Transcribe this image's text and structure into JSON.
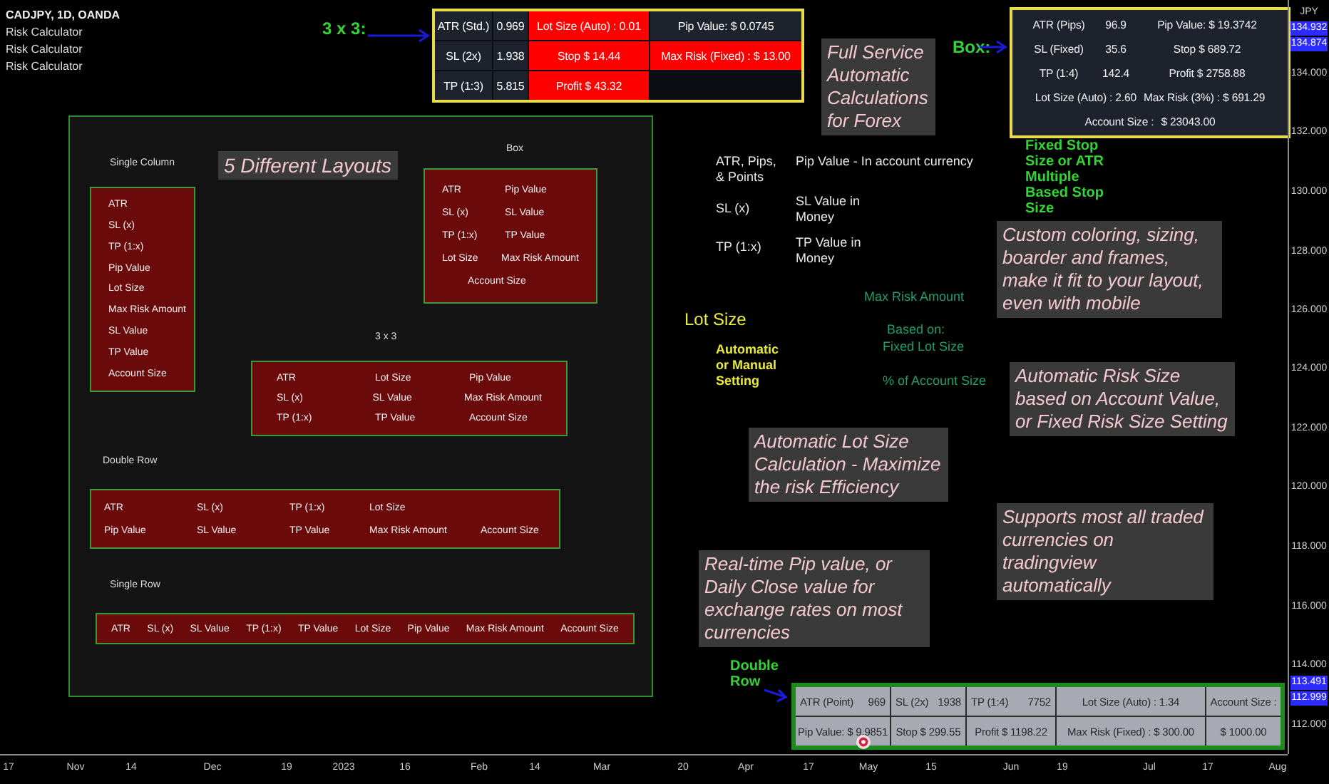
{
  "legend": {
    "title": "CADJPY, 1D, OANDA",
    "indicators": [
      "Risk Calculator",
      "Risk Calculator",
      "Risk Calculator"
    ]
  },
  "table_3x3": {
    "rows": [
      {
        "cells": [
          {
            "text": "ATR (Std.)",
            "highlighted": false
          },
          {
            "text": "0.969",
            "highlighted": false
          },
          {
            "text": "Lot Size (Auto) : 0.01",
            "highlighted": true
          },
          {
            "text": "Pip Value: $ 0.0745",
            "highlighted": false
          }
        ]
      },
      {
        "cells": [
          {
            "text": "SL (2x)",
            "highlighted": false
          },
          {
            "text": "1.938",
            "highlighted": false
          },
          {
            "text": "Stop $ 14.44",
            "highlighted": true
          },
          {
            "text": "Max Risk (Fixed) : $ 13.00",
            "highlighted": true
          }
        ]
      },
      {
        "cells": [
          {
            "text": "TP (1:3)",
            "highlighted": false
          },
          {
            "text": "5.815",
            "highlighted": false
          },
          {
            "text": "Profit $ 43.32",
            "highlighted": true
          }
        ]
      }
    ]
  },
  "table_box": {
    "rows": [
      [
        "ATR (Pips)",
        "96.9",
        "Pip Value: $ 19.3742"
      ],
      [
        "SL (Fixed)",
        "35.6",
        "Stop $ 689.72"
      ],
      [
        "TP (1:4)",
        "142.4",
        "Profit $ 2758.88"
      ],
      [
        "Lot Size (Auto) : 2.60",
        "Max Risk (3%) : $ 691.29"
      ],
      [
        "Account Size :",
        "$ 23043.00"
      ]
    ]
  },
  "table_double_row": {
    "rows": [
      [
        {
          "label": "ATR (Point)",
          "value": "969"
        },
        {
          "label": "SL (2x)",
          "value": "1938"
        },
        {
          "label": "TP (1:4)",
          "value": "7752"
        },
        {
          "label": "Lot Size (Auto) : 1.34"
        },
        {
          "label": "Account Size :"
        }
      ],
      [
        {
          "label": "Pip Value: $ 9.9851"
        },
        {
          "label": "Stop $ 299.55"
        },
        {
          "label": "Profit $ 1198.22"
        },
        {
          "label": "Max Risk (Fixed) : $ 300.00"
        },
        {
          "label": "$ 1000.00"
        }
      ]
    ]
  },
  "layout_demo": {
    "layouts": [
      {
        "title": "Single Column",
        "kind": "single-column",
        "rows": [
          [
            "ATR"
          ],
          [
            "SL (x)"
          ],
          [
            "TP (1:x)"
          ],
          [
            "Pip Value"
          ],
          [
            "Lot Size"
          ],
          [
            "Max Risk Amount"
          ],
          [
            "SL Value"
          ],
          [
            "TP Value"
          ],
          [
            "Account Size"
          ]
        ]
      },
      {
        "title": "Box",
        "kind": "box",
        "rows": [
          [
            "ATR",
            "Pip Value"
          ],
          [
            "SL (x)",
            "SL Value"
          ],
          [
            "TP (1:x)",
            "TP Value"
          ],
          [
            "Lot Size",
            "Max Risk Amount"
          ],
          [
            "Account Size"
          ]
        ]
      },
      {
        "title": "3 x 3",
        "kind": "grid",
        "rows": [
          [
            "ATR",
            "Lot Size",
            "Pip Value"
          ],
          [
            "SL (x)",
            "SL Value",
            "Max Risk Amount"
          ],
          [
            "TP (1:x)",
            "TP Value",
            "Account Size"
          ]
        ]
      },
      {
        "title": "Double Row",
        "kind": "double-row",
        "rows": [
          [
            "ATR",
            "SL (x)",
            "TP (1:x)",
            "Lot Size"
          ],
          [
            "Pip Value",
            "SL Value",
            "TP Value",
            "Max Risk Amount",
            "Account Size"
          ]
        ]
      },
      {
        "title": "Single Row",
        "kind": "single-row",
        "rows": [
          [
            "ATR",
            "SL (x)",
            "SL Value",
            "TP (1:x)",
            "TP Value",
            "Lot Size",
            "Pip Value",
            "Max Risk Amount",
            "Account Size"
          ]
        ]
      }
    ]
  },
  "callouts": [
    "Full Service Automatic Calculations for Forex",
    "5 Different Layouts",
    "Custom coloring, sizing, boarder and frames, make it fit to your layout, even with mobile",
    "Automatic Risk Size based on Account Value, or Fixed Risk Size Setting",
    "Automatic Lot Size Calculation - Maximize the risk Efficiency",
    "Supports most all traded currencies on tradingview automatically",
    "Real-time Pip value, or Daily Close value for exchange rates on most currencies"
  ],
  "notes": [
    {
      "kind": "green",
      "text": "3 x 3:"
    },
    {
      "kind": "green",
      "text": "Box:"
    },
    {
      "kind": "green",
      "text": "Fixed Stop Size or ATR Multiple Based Stop Size"
    },
    {
      "kind": "white",
      "text": "ATR, Pips, & Points"
    },
    {
      "kind": "white",
      "text": "Pip Value - In account currency"
    },
    {
      "kind": "white",
      "text": "SL (x)"
    },
    {
      "kind": "white",
      "text": "SL Value in Money"
    },
    {
      "kind": "white",
      "text": "TP (1:x)"
    },
    {
      "kind": "white",
      "text": "TP Value in Money"
    },
    {
      "kind": "teal",
      "text": "Max Risk Amount"
    },
    {
      "kind": "heading",
      "text": "Lot Size"
    },
    {
      "kind": "teal",
      "text": "Based on:"
    },
    {
      "kind": "yellow",
      "text": "Automatic or Manual Setting"
    },
    {
      "kind": "teal",
      "text": "Fixed Lot Size"
    },
    {
      "kind": "teal",
      "text": "% of Account Size"
    },
    {
      "kind": "green",
      "text": "Double Row"
    }
  ],
  "price_axis": {
    "currency": "JPY",
    "labels": [
      {
        "text": "134.932",
        "highlighted": true
      },
      {
        "text": "134.874",
        "highlighted": true
      },
      {
        "text": "134.000",
        "highlighted": false
      },
      {
        "text": "132.000",
        "highlighted": false
      },
      {
        "text": "130.000",
        "highlighted": false
      },
      {
        "text": "128.000",
        "highlighted": false
      },
      {
        "text": "126.000",
        "highlighted": false
      },
      {
        "text": "124.000",
        "highlighted": false
      },
      {
        "text": "122.000",
        "highlighted": false
      },
      {
        "text": "120.000",
        "highlighted": false
      },
      {
        "text": "118.000",
        "highlighted": false
      },
      {
        "text": "116.000",
        "highlighted": false
      },
      {
        "text": "114.000",
        "highlighted": false
      },
      {
        "text": "113.491",
        "highlighted": true
      },
      {
        "text": "112.999",
        "highlighted": true
      },
      {
        "text": "112.000",
        "highlighted": false
      }
    ]
  },
  "time_axis": {
    "labels": [
      "17",
      "Nov",
      "14",
      "Dec",
      "19",
      "2023",
      "16",
      "Feb",
      "14",
      "Mar",
      "20",
      "Apr",
      "17",
      "May",
      "15",
      "Jun",
      "19",
      "Jul",
      "17",
      "Aug"
    ]
  }
}
